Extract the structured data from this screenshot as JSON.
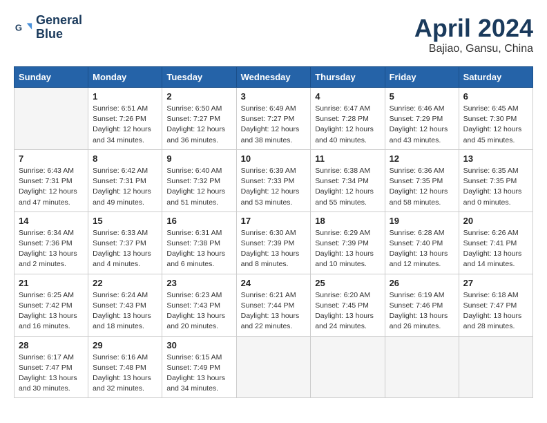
{
  "header": {
    "logo_line1": "General",
    "logo_line2": "Blue",
    "month_title": "April 2024",
    "location": "Bajiao, Gansu, China"
  },
  "days_of_week": [
    "Sunday",
    "Monday",
    "Tuesday",
    "Wednesday",
    "Thursday",
    "Friday",
    "Saturday"
  ],
  "weeks": [
    [
      {
        "day": "",
        "sunrise": "",
        "sunset": "",
        "daylight": ""
      },
      {
        "day": "1",
        "sunrise": "Sunrise: 6:51 AM",
        "sunset": "Sunset: 7:26 PM",
        "daylight": "Daylight: 12 hours and 34 minutes."
      },
      {
        "day": "2",
        "sunrise": "Sunrise: 6:50 AM",
        "sunset": "Sunset: 7:27 PM",
        "daylight": "Daylight: 12 hours and 36 minutes."
      },
      {
        "day": "3",
        "sunrise": "Sunrise: 6:49 AM",
        "sunset": "Sunset: 7:27 PM",
        "daylight": "Daylight: 12 hours and 38 minutes."
      },
      {
        "day": "4",
        "sunrise": "Sunrise: 6:47 AM",
        "sunset": "Sunset: 7:28 PM",
        "daylight": "Daylight: 12 hours and 40 minutes."
      },
      {
        "day": "5",
        "sunrise": "Sunrise: 6:46 AM",
        "sunset": "Sunset: 7:29 PM",
        "daylight": "Daylight: 12 hours and 43 minutes."
      },
      {
        "day": "6",
        "sunrise": "Sunrise: 6:45 AM",
        "sunset": "Sunset: 7:30 PM",
        "daylight": "Daylight: 12 hours and 45 minutes."
      }
    ],
    [
      {
        "day": "7",
        "sunrise": "Sunrise: 6:43 AM",
        "sunset": "Sunset: 7:31 PM",
        "daylight": "Daylight: 12 hours and 47 minutes."
      },
      {
        "day": "8",
        "sunrise": "Sunrise: 6:42 AM",
        "sunset": "Sunset: 7:31 PM",
        "daylight": "Daylight: 12 hours and 49 minutes."
      },
      {
        "day": "9",
        "sunrise": "Sunrise: 6:40 AM",
        "sunset": "Sunset: 7:32 PM",
        "daylight": "Daylight: 12 hours and 51 minutes."
      },
      {
        "day": "10",
        "sunrise": "Sunrise: 6:39 AM",
        "sunset": "Sunset: 7:33 PM",
        "daylight": "Daylight: 12 hours and 53 minutes."
      },
      {
        "day": "11",
        "sunrise": "Sunrise: 6:38 AM",
        "sunset": "Sunset: 7:34 PM",
        "daylight": "Daylight: 12 hours and 55 minutes."
      },
      {
        "day": "12",
        "sunrise": "Sunrise: 6:36 AM",
        "sunset": "Sunset: 7:35 PM",
        "daylight": "Daylight: 12 hours and 58 minutes."
      },
      {
        "day": "13",
        "sunrise": "Sunrise: 6:35 AM",
        "sunset": "Sunset: 7:35 PM",
        "daylight": "Daylight: 13 hours and 0 minutes."
      }
    ],
    [
      {
        "day": "14",
        "sunrise": "Sunrise: 6:34 AM",
        "sunset": "Sunset: 7:36 PM",
        "daylight": "Daylight: 13 hours and 2 minutes."
      },
      {
        "day": "15",
        "sunrise": "Sunrise: 6:33 AM",
        "sunset": "Sunset: 7:37 PM",
        "daylight": "Daylight: 13 hours and 4 minutes."
      },
      {
        "day": "16",
        "sunrise": "Sunrise: 6:31 AM",
        "sunset": "Sunset: 7:38 PM",
        "daylight": "Daylight: 13 hours and 6 minutes."
      },
      {
        "day": "17",
        "sunrise": "Sunrise: 6:30 AM",
        "sunset": "Sunset: 7:39 PM",
        "daylight": "Daylight: 13 hours and 8 minutes."
      },
      {
        "day": "18",
        "sunrise": "Sunrise: 6:29 AM",
        "sunset": "Sunset: 7:39 PM",
        "daylight": "Daylight: 13 hours and 10 minutes."
      },
      {
        "day": "19",
        "sunrise": "Sunrise: 6:28 AM",
        "sunset": "Sunset: 7:40 PM",
        "daylight": "Daylight: 13 hours and 12 minutes."
      },
      {
        "day": "20",
        "sunrise": "Sunrise: 6:26 AM",
        "sunset": "Sunset: 7:41 PM",
        "daylight": "Daylight: 13 hours and 14 minutes."
      }
    ],
    [
      {
        "day": "21",
        "sunrise": "Sunrise: 6:25 AM",
        "sunset": "Sunset: 7:42 PM",
        "daylight": "Daylight: 13 hours and 16 minutes."
      },
      {
        "day": "22",
        "sunrise": "Sunrise: 6:24 AM",
        "sunset": "Sunset: 7:43 PM",
        "daylight": "Daylight: 13 hours and 18 minutes."
      },
      {
        "day": "23",
        "sunrise": "Sunrise: 6:23 AM",
        "sunset": "Sunset: 7:43 PM",
        "daylight": "Daylight: 13 hours and 20 minutes."
      },
      {
        "day": "24",
        "sunrise": "Sunrise: 6:21 AM",
        "sunset": "Sunset: 7:44 PM",
        "daylight": "Daylight: 13 hours and 22 minutes."
      },
      {
        "day": "25",
        "sunrise": "Sunrise: 6:20 AM",
        "sunset": "Sunset: 7:45 PM",
        "daylight": "Daylight: 13 hours and 24 minutes."
      },
      {
        "day": "26",
        "sunrise": "Sunrise: 6:19 AM",
        "sunset": "Sunset: 7:46 PM",
        "daylight": "Daylight: 13 hours and 26 minutes."
      },
      {
        "day": "27",
        "sunrise": "Sunrise: 6:18 AM",
        "sunset": "Sunset: 7:47 PM",
        "daylight": "Daylight: 13 hours and 28 minutes."
      }
    ],
    [
      {
        "day": "28",
        "sunrise": "Sunrise: 6:17 AM",
        "sunset": "Sunset: 7:47 PM",
        "daylight": "Daylight: 13 hours and 30 minutes."
      },
      {
        "day": "29",
        "sunrise": "Sunrise: 6:16 AM",
        "sunset": "Sunset: 7:48 PM",
        "daylight": "Daylight: 13 hours and 32 minutes."
      },
      {
        "day": "30",
        "sunrise": "Sunrise: 6:15 AM",
        "sunset": "Sunset: 7:49 PM",
        "daylight": "Daylight: 13 hours and 34 minutes."
      },
      {
        "day": "",
        "sunrise": "",
        "sunset": "",
        "daylight": ""
      },
      {
        "day": "",
        "sunrise": "",
        "sunset": "",
        "daylight": ""
      },
      {
        "day": "",
        "sunrise": "",
        "sunset": "",
        "daylight": ""
      },
      {
        "day": "",
        "sunrise": "",
        "sunset": "",
        "daylight": ""
      }
    ]
  ]
}
